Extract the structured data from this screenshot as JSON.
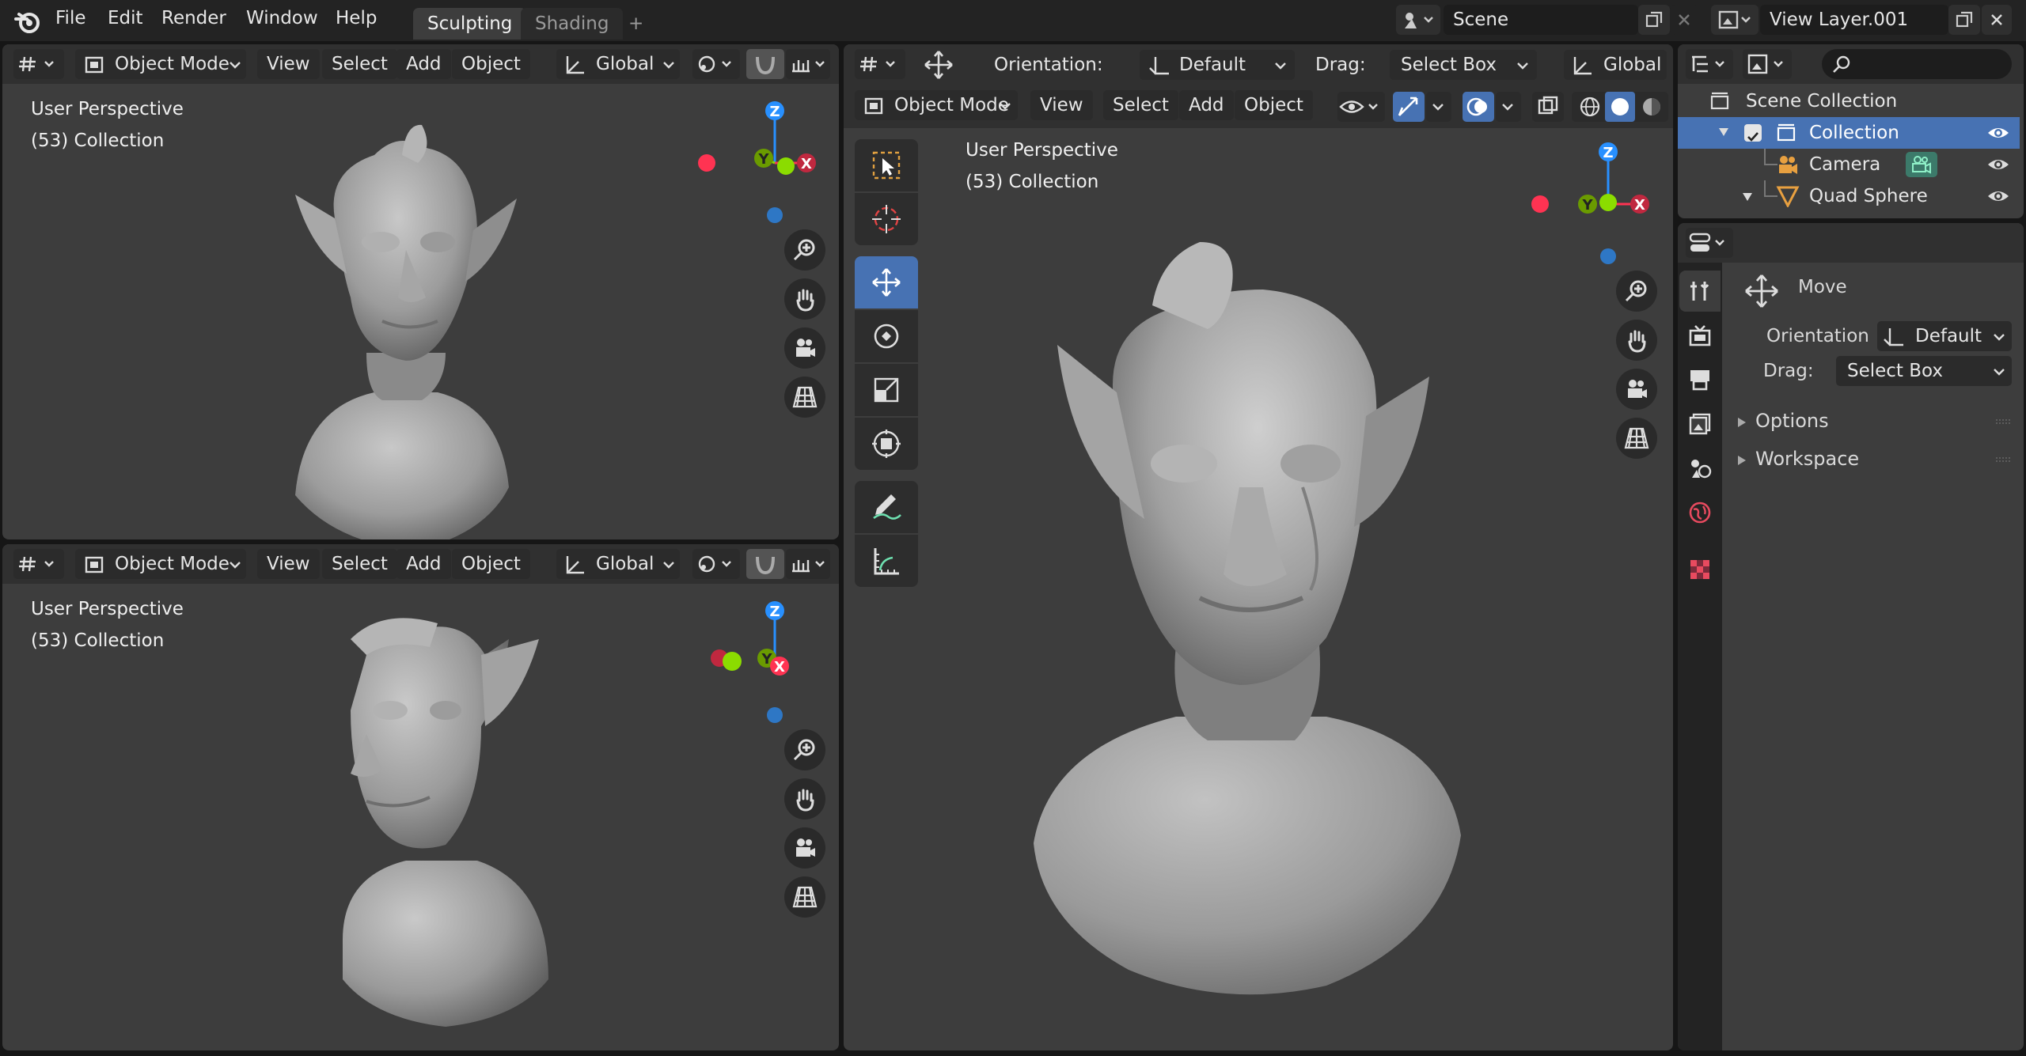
{
  "topbar": {
    "menus": [
      "File",
      "Edit",
      "Render",
      "Window",
      "Help"
    ],
    "tabs": [
      {
        "label": "Sculpting",
        "active": true
      },
      {
        "label": "Shading",
        "active": false
      }
    ],
    "add_tab": "+",
    "scene": "Scene",
    "view_layer": "View Layer.001"
  },
  "viewports": {
    "top_left": {
      "mode": "Object Mode",
      "menus": [
        "View",
        "Select",
        "Add",
        "Object"
      ],
      "transform": "Global",
      "perspective": "User Perspective",
      "collection": "(53) Collection"
    },
    "bottom_left": {
      "mode": "Object Mode",
      "menus": [
        "View",
        "Select",
        "Add",
        "Object"
      ],
      "transform": "Global",
      "perspective": "User Perspective",
      "collection": "(53) Collection"
    },
    "main": {
      "orientation_label": "Orientation:",
      "orientation": "Default",
      "drag_label": "Drag:",
      "drag": "Select Box",
      "transform": "Global",
      "mode": "Object Mode",
      "menus": [
        "View",
        "Select",
        "Add",
        "Object"
      ],
      "perspective": "User Perspective",
      "collection": "(53) Collection"
    }
  },
  "gizmo": {
    "x": "X",
    "y": "Y",
    "z": "Z"
  },
  "outliner": {
    "root": "Scene Collection",
    "items": [
      {
        "label": "Collection",
        "selected": true
      },
      {
        "label": "Camera",
        "selected": false
      },
      {
        "label": "Quad Sphere",
        "selected": false
      }
    ]
  },
  "properties": {
    "tool_name": "Move",
    "orientation_label": "Orientation",
    "orientation": "Default",
    "drag_label": "Drag:",
    "drag": "Select Box",
    "sections": [
      "Options",
      "Workspace"
    ]
  },
  "colors": {
    "accent": "#4772b3",
    "axis_x": "#ff3352",
    "axis_y": "#8bdc00",
    "axis_z": "#2890ff"
  }
}
